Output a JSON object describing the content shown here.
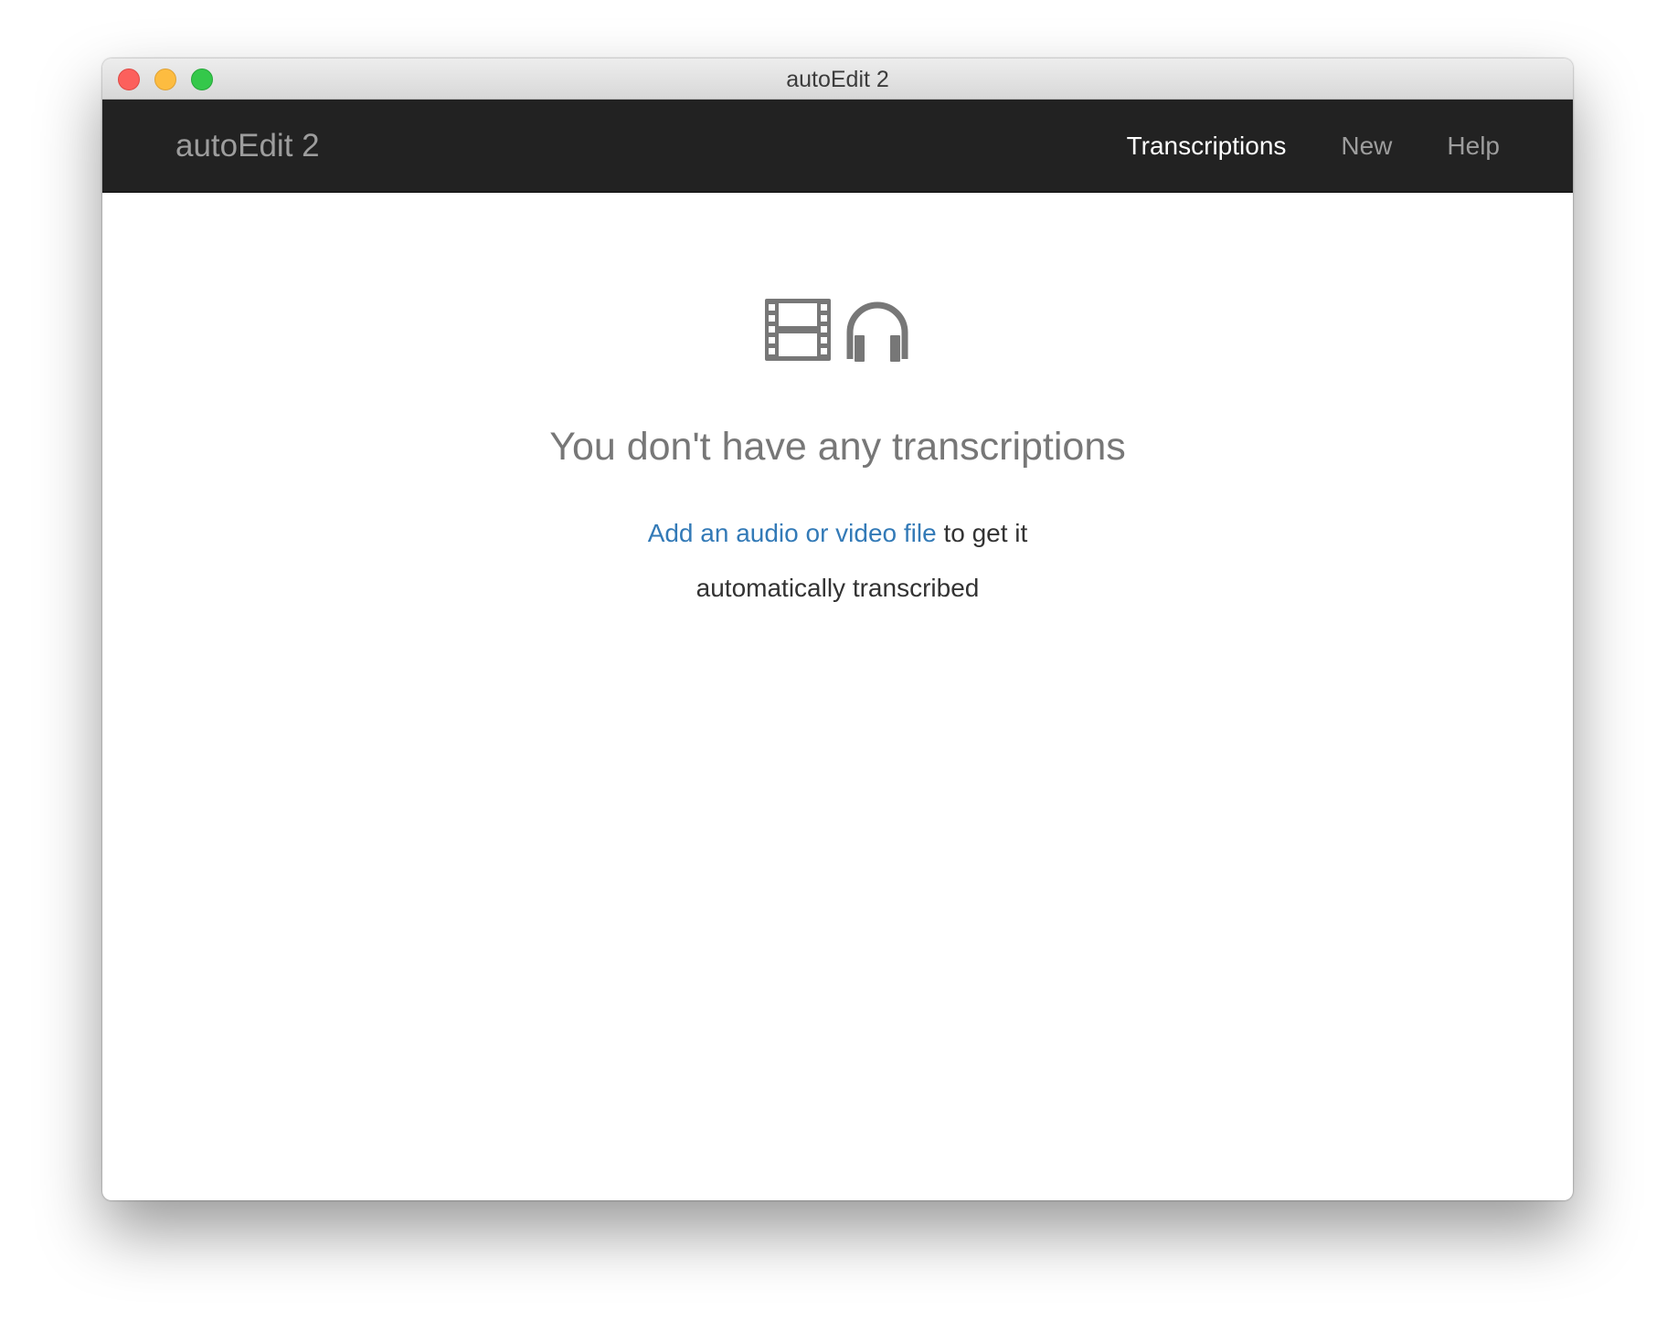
{
  "window": {
    "title": "autoEdit 2"
  },
  "navbar": {
    "brand": "autoEdit 2",
    "items": [
      {
        "label": "Transcriptions",
        "active": true
      },
      {
        "label": "New",
        "active": false
      },
      {
        "label": "Help",
        "active": false
      }
    ]
  },
  "empty_state": {
    "icons": [
      "film-icon",
      "headphones-icon"
    ],
    "heading": "You don't have any transcriptions",
    "link_text": "Add an audio or video file",
    "line1_rest": " to get it",
    "line2": "automatically transcribed"
  },
  "colors": {
    "navbar_bg": "#222222",
    "link": "#337ab7",
    "icon_gray": "#777777",
    "close_button": "#fc605c",
    "minimize_button": "#fdbc40",
    "zoom_button": "#34c84a"
  }
}
